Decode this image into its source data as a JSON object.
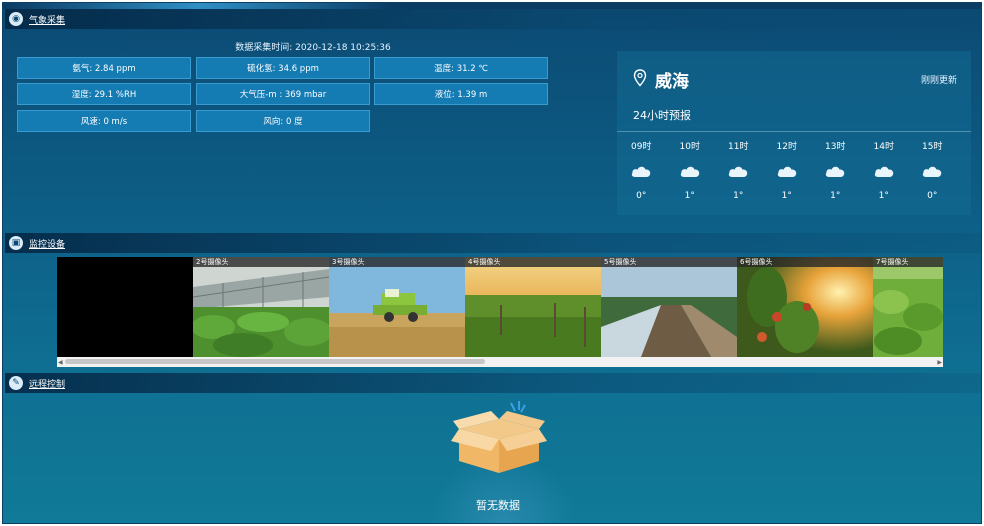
{
  "sections": {
    "weather": {
      "title": "气象采集"
    },
    "monitor": {
      "title": "监控设备"
    },
    "control": {
      "title": "远程控制"
    }
  },
  "weather": {
    "data_time": "数据采集时间: 2020-12-18 10:25:36",
    "cells": [
      "氨气: 2.84 ppm",
      "硫化氢: 34.6 ppm",
      "温度: 31.2 ℃",
      "湿度: 29.1 %RH",
      "大气压-m : 369 mbar",
      "液位: 1.39 m",
      "风速: 0 m/s",
      "风向: 0 度"
    ]
  },
  "forecast": {
    "city": "威海",
    "refresh": "刚刚更新",
    "subtitle": "24小时预报",
    "hours": [
      {
        "hour": "09时",
        "temp": "0°",
        "icon": "cloud-icon"
      },
      {
        "hour": "10时",
        "temp": "1°",
        "icon": "cloud-icon"
      },
      {
        "hour": "11时",
        "temp": "1°",
        "icon": "cloud-icon"
      },
      {
        "hour": "12时",
        "temp": "1°",
        "icon": "cloud-icon"
      },
      {
        "hour": "13时",
        "temp": "1°",
        "icon": "cloud-icon"
      },
      {
        "hour": "14时",
        "temp": "1°",
        "icon": "cloud-icon"
      },
      {
        "hour": "15时",
        "temp": "0°",
        "icon": "cloud-icon"
      }
    ]
  },
  "cameras": [
    {
      "label": ""
    },
    {
      "label": "2号摄像头"
    },
    {
      "label": "3号摄像头"
    },
    {
      "label": "4号摄像头"
    },
    {
      "label": "5号摄像头"
    },
    {
      "label": "6号摄像头"
    },
    {
      "label": "7号摄像头"
    }
  ],
  "control": {
    "empty_text": "暂无数据"
  },
  "colors": {
    "cell_bg": "#157bb3",
    "panel_bg": "#0d5e86"
  }
}
